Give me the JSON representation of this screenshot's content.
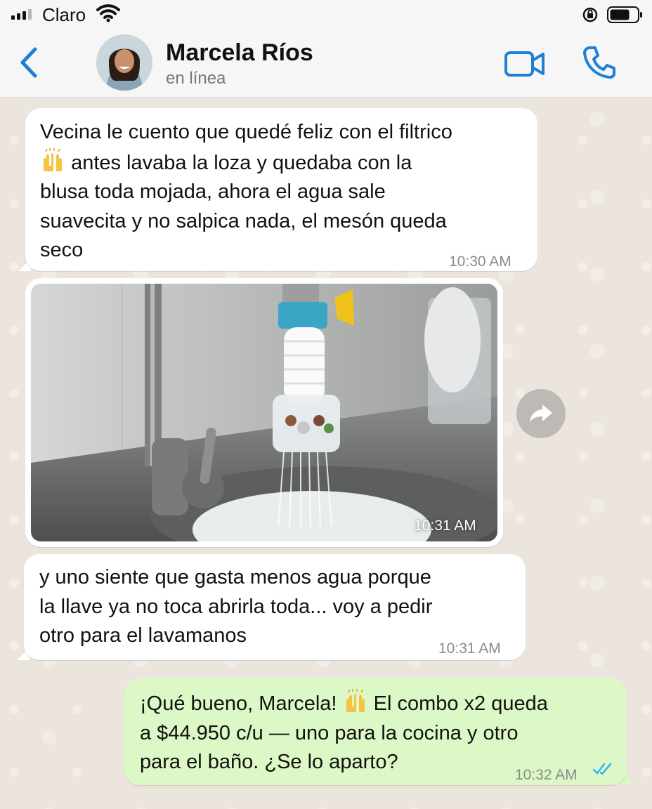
{
  "status_bar": {
    "carrier": "Claro"
  },
  "header": {
    "contact_name": "Marcela Ríos",
    "presence": "en línea"
  },
  "messages": [
    {
      "direction": "in",
      "lines": [
        "Vecina le cuento que quedé feliz con el filtrico",
        "antes lavaba la loza y quedaba con la",
        "blusa toda mojada, ahora el agua sale",
        "suavecita y no salpica nada, el mesón queda",
        "seco"
      ],
      "time": "10:30 AM"
    },
    {
      "direction": "in",
      "type": "image",
      "image_alt": "faucet-filter-photo",
      "time": "10:31 AM"
    },
    {
      "direction": "in",
      "lines": [
        "y uno siente que gasta menos agua porque",
        "la llave ya no toca abrirla toda... voy a pedir",
        "otro para el lavamanos"
      ],
      "time": "10:31 AM"
    },
    {
      "direction": "out",
      "lines": [
        "¡Qué bueno, Marcela!",
        "El combo x2 queda",
        "a $44.950 c/u — uno para la cocina y otro",
        "para el baño. ¿Se lo aparto?"
      ],
      "time": "10:32 AM",
      "status": "read"
    }
  ],
  "icons": {
    "back": "chevron-left-icon",
    "video": "video-call-icon",
    "call": "phone-icon",
    "forward": "forward-arrow-icon",
    "emoji": "raising-hands-emoji",
    "read": "double-check-icon"
  },
  "colors": {
    "accent": "#1f7fd8",
    "incoming_bubble": "#ffffff",
    "outgoing_bubble": "#dcf8c6",
    "read_ticks": "#34b7f1"
  }
}
